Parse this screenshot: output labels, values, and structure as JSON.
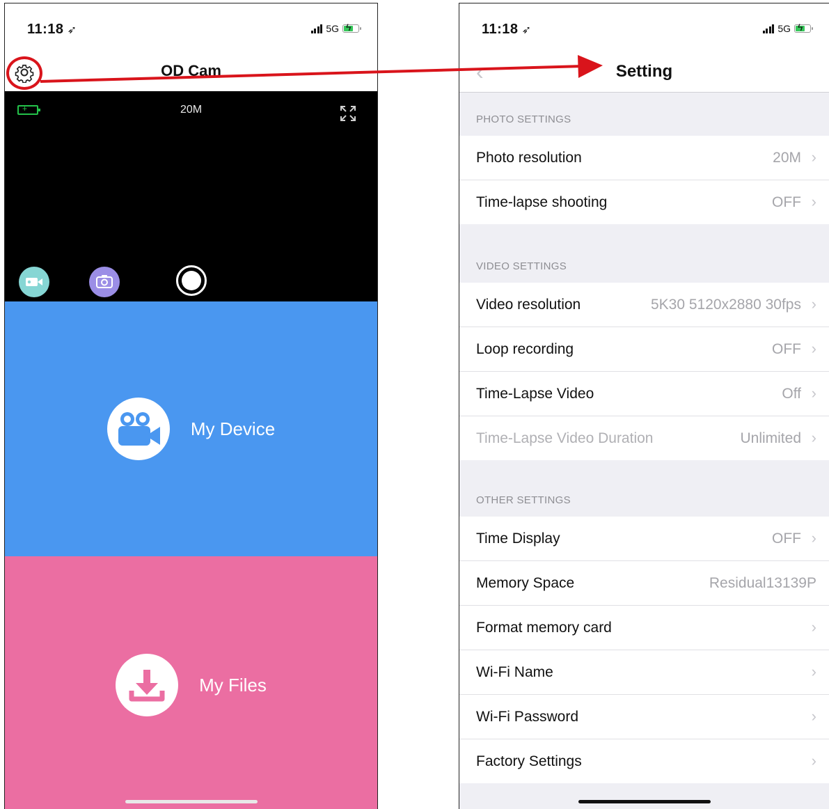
{
  "left_phone": {
    "status": {
      "time": "11:18",
      "network": "5G"
    },
    "nav": {
      "title": "OD Cam"
    },
    "preview": {
      "resolution": "20M"
    },
    "tiles": {
      "device_label": "My Device",
      "files_label": "My Files"
    }
  },
  "right_phone": {
    "status": {
      "time": "11:18",
      "network": "5G"
    },
    "nav": {
      "title": "Setting"
    },
    "sections": [
      {
        "header": "PHOTO SETTINGS",
        "rows": [
          {
            "label": "Photo resolution",
            "value": "20M"
          },
          {
            "label": "Time-lapse shooting",
            "value": "OFF"
          }
        ]
      },
      {
        "header": "VIDEO SETTINGS",
        "rows": [
          {
            "label": "Video resolution",
            "value": "5K30 5120x2880 30fps"
          },
          {
            "label": "Loop recording",
            "value": "OFF"
          },
          {
            "label": "Time-Lapse Video",
            "value": "Off"
          },
          {
            "label": "Time-Lapse Video Duration",
            "value": "Unlimited"
          }
        ]
      },
      {
        "header": "OTHER SETTINGS",
        "rows": [
          {
            "label": "Time Display",
            "value": "OFF"
          },
          {
            "label": "Memory Space",
            "value": "Residual13139P"
          },
          {
            "label": "Format memory card",
            "value": ""
          },
          {
            "label": "Wi-Fi Name",
            "value": ""
          },
          {
            "label": "Wi-Fi Password",
            "value": ""
          },
          {
            "label": "Factory Settings",
            "value": ""
          }
        ]
      }
    ]
  },
  "colors": {
    "device_tile": "#4a97f0",
    "files_tile": "#eb6ea2",
    "annotation_red": "#d9141b",
    "video_mode": "#86d6d4",
    "photo_mode": "#9b8ee6"
  }
}
